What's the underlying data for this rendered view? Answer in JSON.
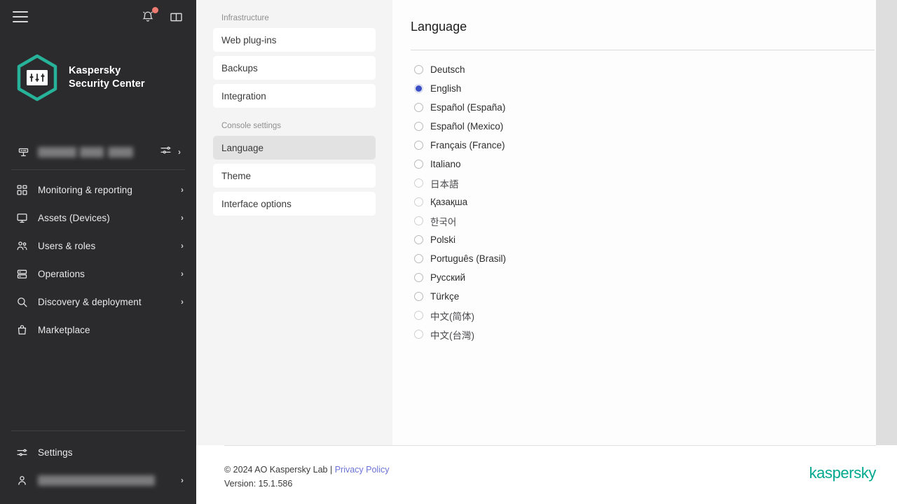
{
  "sidebar": {
    "topbar": {
      "menu_icon": "hamburger-menu-icon",
      "notifications_icon": "bell-icon",
      "help_icon": "book-icon"
    },
    "brand": {
      "line1": "Kaspersky",
      "line2": "Security Center",
      "logo_icon": "kaspersky-hexagon-logo",
      "accent_color": "#27b39a"
    },
    "account": {
      "server_icon": "server-icon",
      "name": "",
      "redacted": true,
      "settings_icon": "sliders-icon",
      "chevron": "›"
    },
    "items": [
      {
        "label": "Monitoring & reporting",
        "icon": "dashboard-icon",
        "chevron": "›"
      },
      {
        "label": "Assets (Devices)",
        "icon": "monitor-icon",
        "chevron": "›"
      },
      {
        "label": "Users & roles",
        "icon": "users-icon",
        "chevron": "›"
      },
      {
        "label": "Operations",
        "icon": "server-stack-icon",
        "chevron": "›"
      },
      {
        "label": "Discovery & deployment",
        "icon": "search-icon",
        "chevron": "›"
      },
      {
        "label": "Marketplace",
        "icon": "bag-icon",
        "chevron": ""
      }
    ],
    "bottom": {
      "settings_label": "Settings",
      "settings_icon": "sliders-icon",
      "user_icon": "user-icon",
      "user_name": "",
      "user_redacted": true,
      "chevron": "›"
    }
  },
  "midpanel": {
    "groups": [
      {
        "title": "Infrastructure",
        "items": [
          {
            "label": "Web plug-ins",
            "selected": false
          },
          {
            "label": "Backups",
            "selected": false
          },
          {
            "label": "Integration",
            "selected": false
          }
        ]
      },
      {
        "title": "Console settings",
        "items": [
          {
            "label": "Language",
            "selected": true
          },
          {
            "label": "Theme",
            "selected": false
          },
          {
            "label": "Interface options",
            "selected": false
          }
        ]
      }
    ]
  },
  "main": {
    "title": "Language",
    "selected_value": "English",
    "accent_color": "#3a4fc4",
    "languages": [
      {
        "label": "Deutsch",
        "selected": false,
        "cjk": false
      },
      {
        "label": "English",
        "selected": true,
        "cjk": false
      },
      {
        "label": "Español (España)",
        "selected": false,
        "cjk": false
      },
      {
        "label": "Español (Mexico)",
        "selected": false,
        "cjk": false
      },
      {
        "label": "Français (France)",
        "selected": false,
        "cjk": false
      },
      {
        "label": "Italiano",
        "selected": false,
        "cjk": false
      },
      {
        "label": "日本語",
        "selected": false,
        "cjk": true
      },
      {
        "label": "Қазақша",
        "selected": false,
        "cjk": false
      },
      {
        "label": "한국어",
        "selected": false,
        "cjk": true
      },
      {
        "label": "Polski",
        "selected": false,
        "cjk": false
      },
      {
        "label": "Português (Brasil)",
        "selected": false,
        "cjk": false
      },
      {
        "label": "Русский",
        "selected": false,
        "cjk": false
      },
      {
        "label": "Türkçe",
        "selected": false,
        "cjk": false
      },
      {
        "label": "中文(简体)",
        "selected": false,
        "cjk": true
      },
      {
        "label": "中文(台灣)",
        "selected": false,
        "cjk": true
      }
    ]
  },
  "footer": {
    "copyright": "© 2024 AO Kaspersky Lab | ",
    "privacy_link": "Privacy Policy",
    "version": "Version: 15.1.586",
    "wordmark": "kaspersky",
    "wordmark_color": "#00a88e"
  }
}
